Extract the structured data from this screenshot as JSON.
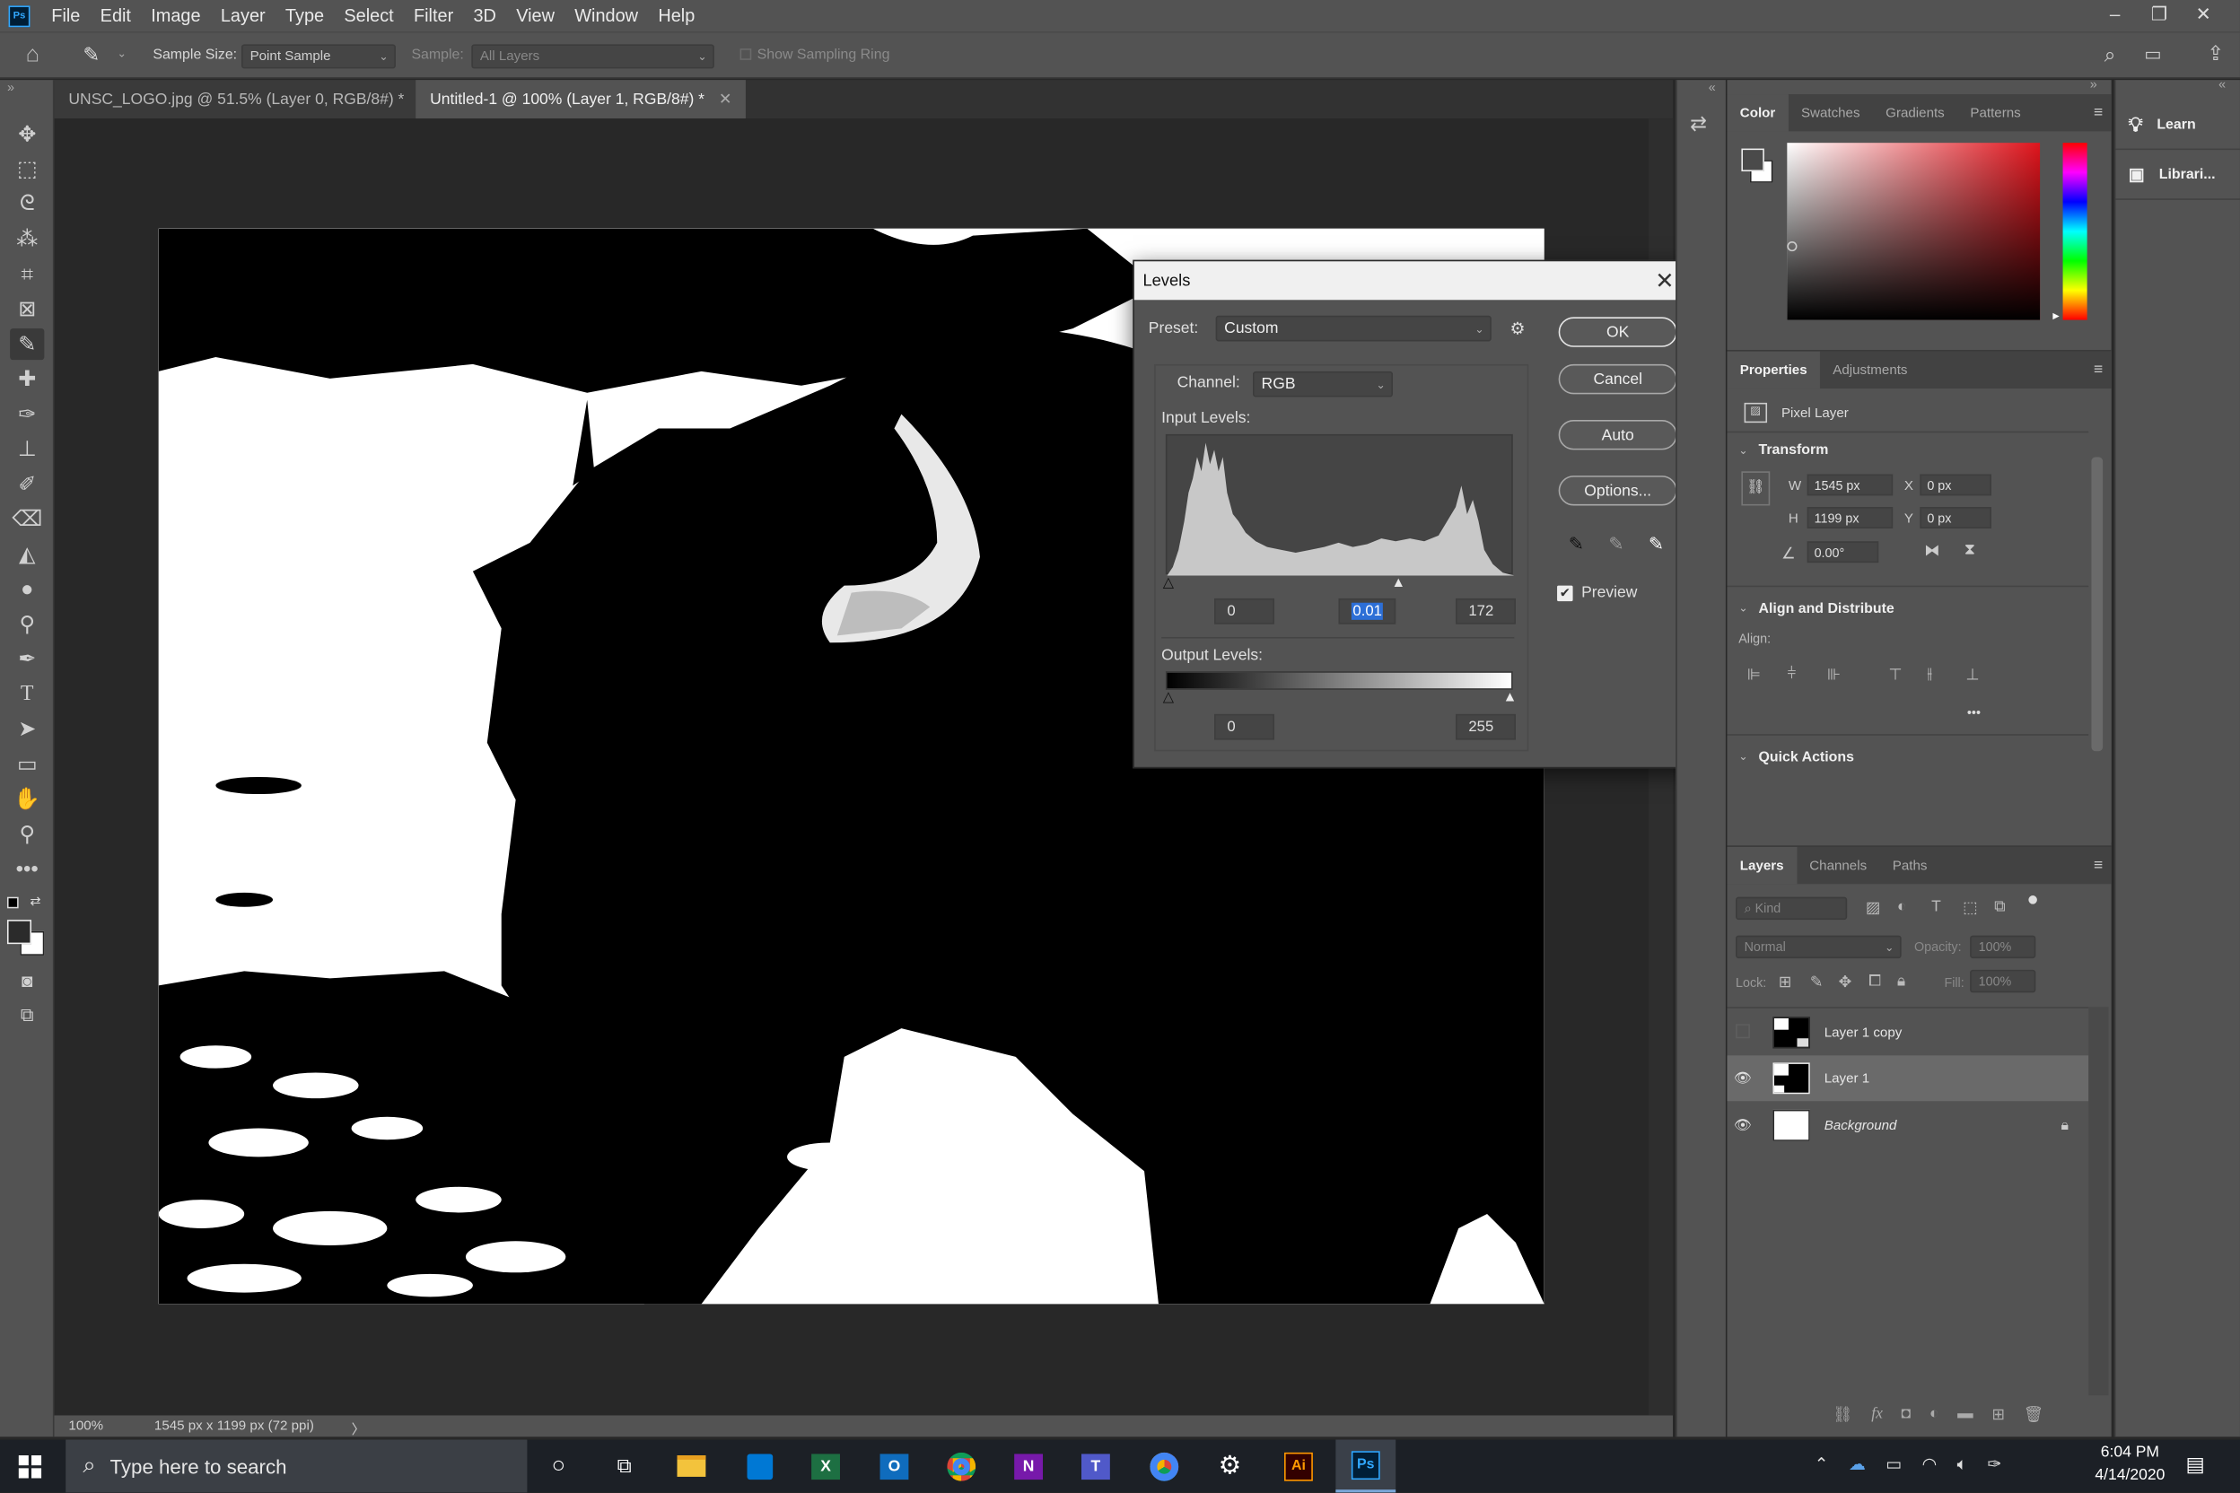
{
  "menubar": {
    "app_icon": "Ps",
    "items": [
      "File",
      "Edit",
      "Image",
      "Layer",
      "Type",
      "Select",
      "Filter",
      "3D",
      "View",
      "Window",
      "Help"
    ]
  },
  "optionsbar": {
    "sample_size_label": "Sample Size:",
    "sample_size_value": "Point Sample",
    "sample_label": "Sample:",
    "sample_value": "All Layers",
    "sampling_ring_label": "Show Sampling Ring"
  },
  "doc_tabs": [
    {
      "title": "UNSC_LOGO.jpg @ 51.5% (Layer 0, RGB/8#) *"
    },
    {
      "title": "Untitled-1 @ 100% (Layer 1, RGB/8#) *"
    }
  ],
  "statusbar": {
    "zoom": "100%",
    "doc_info": "1545 px x 1199 px (72 ppi)",
    "arrow": "〉"
  },
  "levels_dialog": {
    "title": "Levels",
    "preset_label": "Preset:",
    "preset_value": "Custom",
    "channel_label": "Channel:",
    "channel_value": "RGB",
    "input_levels_label": "Input Levels:",
    "input_black": "0",
    "input_gamma": "0.01",
    "input_white": "172",
    "output_levels_label": "Output Levels:",
    "output_black": "0",
    "output_white": "255",
    "buttons": {
      "ok": "OK",
      "cancel": "Cancel",
      "auto": "Auto",
      "options": "Options..."
    },
    "preview_label": "Preview",
    "preview_checked": true
  },
  "color_panel": {
    "tabs": [
      "Color",
      "Swatches",
      "Gradients",
      "Patterns"
    ],
    "hue_color": "#e0141c"
  },
  "properties_panel": {
    "tabs": [
      "Properties",
      "Adjustments"
    ],
    "layer_type": "Pixel Layer",
    "transform_title": "Transform",
    "w_label": "W",
    "w_value": "1545 px",
    "h_label": "H",
    "h_value": "1199 px",
    "x_label": "X",
    "x_value": "0 px",
    "y_label": "Y",
    "y_value": "0 px",
    "angle_value": "0.00°",
    "align_title": "Align and Distribute",
    "align_label": "Align:",
    "more": "•••",
    "quick_actions_title": "Quick Actions"
  },
  "layers_panel": {
    "tabs": [
      "Layers",
      "Channels",
      "Paths"
    ],
    "kind_placeholder": "Kind",
    "blend_mode": "Normal",
    "opacity_label": "Opacity:",
    "opacity_value": "100%",
    "lock_label": "Lock:",
    "fill_label": "Fill:",
    "fill_value": "100%",
    "layers": [
      {
        "name": "Layer 1 copy",
        "visible": false,
        "selected": false
      },
      {
        "name": "Layer 1",
        "visible": true,
        "selected": true
      },
      {
        "name": "Background",
        "visible": true,
        "selected": false,
        "locked": true
      }
    ],
    "footer_icons": [
      "link-icon",
      "fx-icon",
      "mask-icon",
      "adjustment-icon",
      "folder-icon",
      "new-layer-icon",
      "trash-icon"
    ]
  },
  "right_dock": {
    "items": [
      "Learn",
      "Librari..."
    ]
  },
  "taskbar": {
    "search_placeholder": "Type here to search",
    "time": "6:04 PM",
    "date": "4/14/2020",
    "apps": [
      "file-explorer-icon",
      "store-icon",
      "excel-icon",
      "outlook-icon",
      "chrome-icon",
      "onenote-icon",
      "teams-icon",
      "chrome-icon",
      "settings-icon",
      "illustrator-icon",
      "photoshop-icon"
    ]
  }
}
